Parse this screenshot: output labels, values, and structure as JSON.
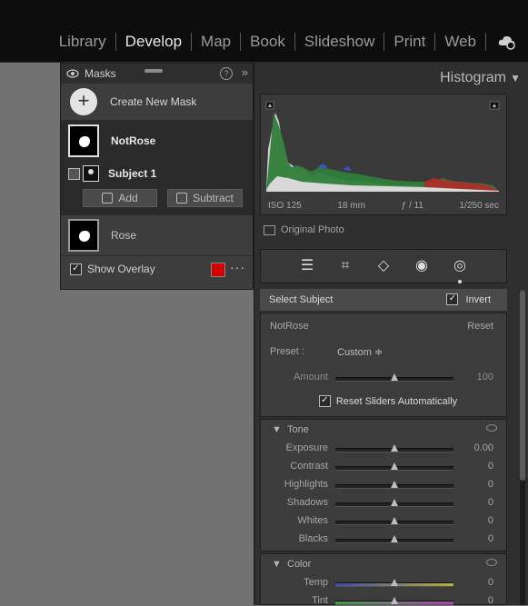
{
  "modules": [
    "Library",
    "Develop",
    "Map",
    "Book",
    "Slideshow",
    "Print",
    "Web"
  ],
  "active_module": "Develop",
  "masks_panel": {
    "title": "Masks",
    "create_label": "Create New Mask",
    "mask1_name": "NotRose",
    "subject_name": "Subject 1",
    "add_label": "Add",
    "subtract_label": "Subtract",
    "mask2_name": "Rose",
    "show_overlay_label": "Show Overlay",
    "overlay_color": "#d40000"
  },
  "histogram": {
    "title": "Histogram",
    "iso": "ISO 125",
    "focal": "18 mm",
    "aperture": "ƒ / 11",
    "shutter": "1/250 sec",
    "original_photo_label": "Original Photo"
  },
  "select_subject": {
    "label": "Select Subject",
    "invert_label": "Invert"
  },
  "mask_props": {
    "name": "NotRose",
    "reset_label": "Reset",
    "preset_label": "Preset :",
    "preset_value": "Custom ≑",
    "amount_label": "Amount",
    "amount_value": "100",
    "amount_fraction": 0.5,
    "reset_sliders_label": "Reset Sliders Automatically"
  },
  "tone": {
    "title": "Tone",
    "sliders": [
      {
        "label": "Exposure",
        "value": "0.00",
        "fraction": 0.5
      },
      {
        "label": "Contrast",
        "value": "0",
        "fraction": 0.5
      },
      {
        "label": "Highlights",
        "value": "0",
        "fraction": 0.5
      },
      {
        "label": "Shadows",
        "value": "0",
        "fraction": 0.5
      },
      {
        "label": "Whites",
        "value": "0",
        "fraction": 0.5
      },
      {
        "label": "Blacks",
        "value": "0",
        "fraction": 0.5
      }
    ]
  },
  "color": {
    "title": "Color",
    "sliders": [
      {
        "label": "Temp",
        "value": "0",
        "fraction": 0.5
      },
      {
        "label": "Tint",
        "value": "0",
        "fraction": 0.5
      }
    ]
  }
}
